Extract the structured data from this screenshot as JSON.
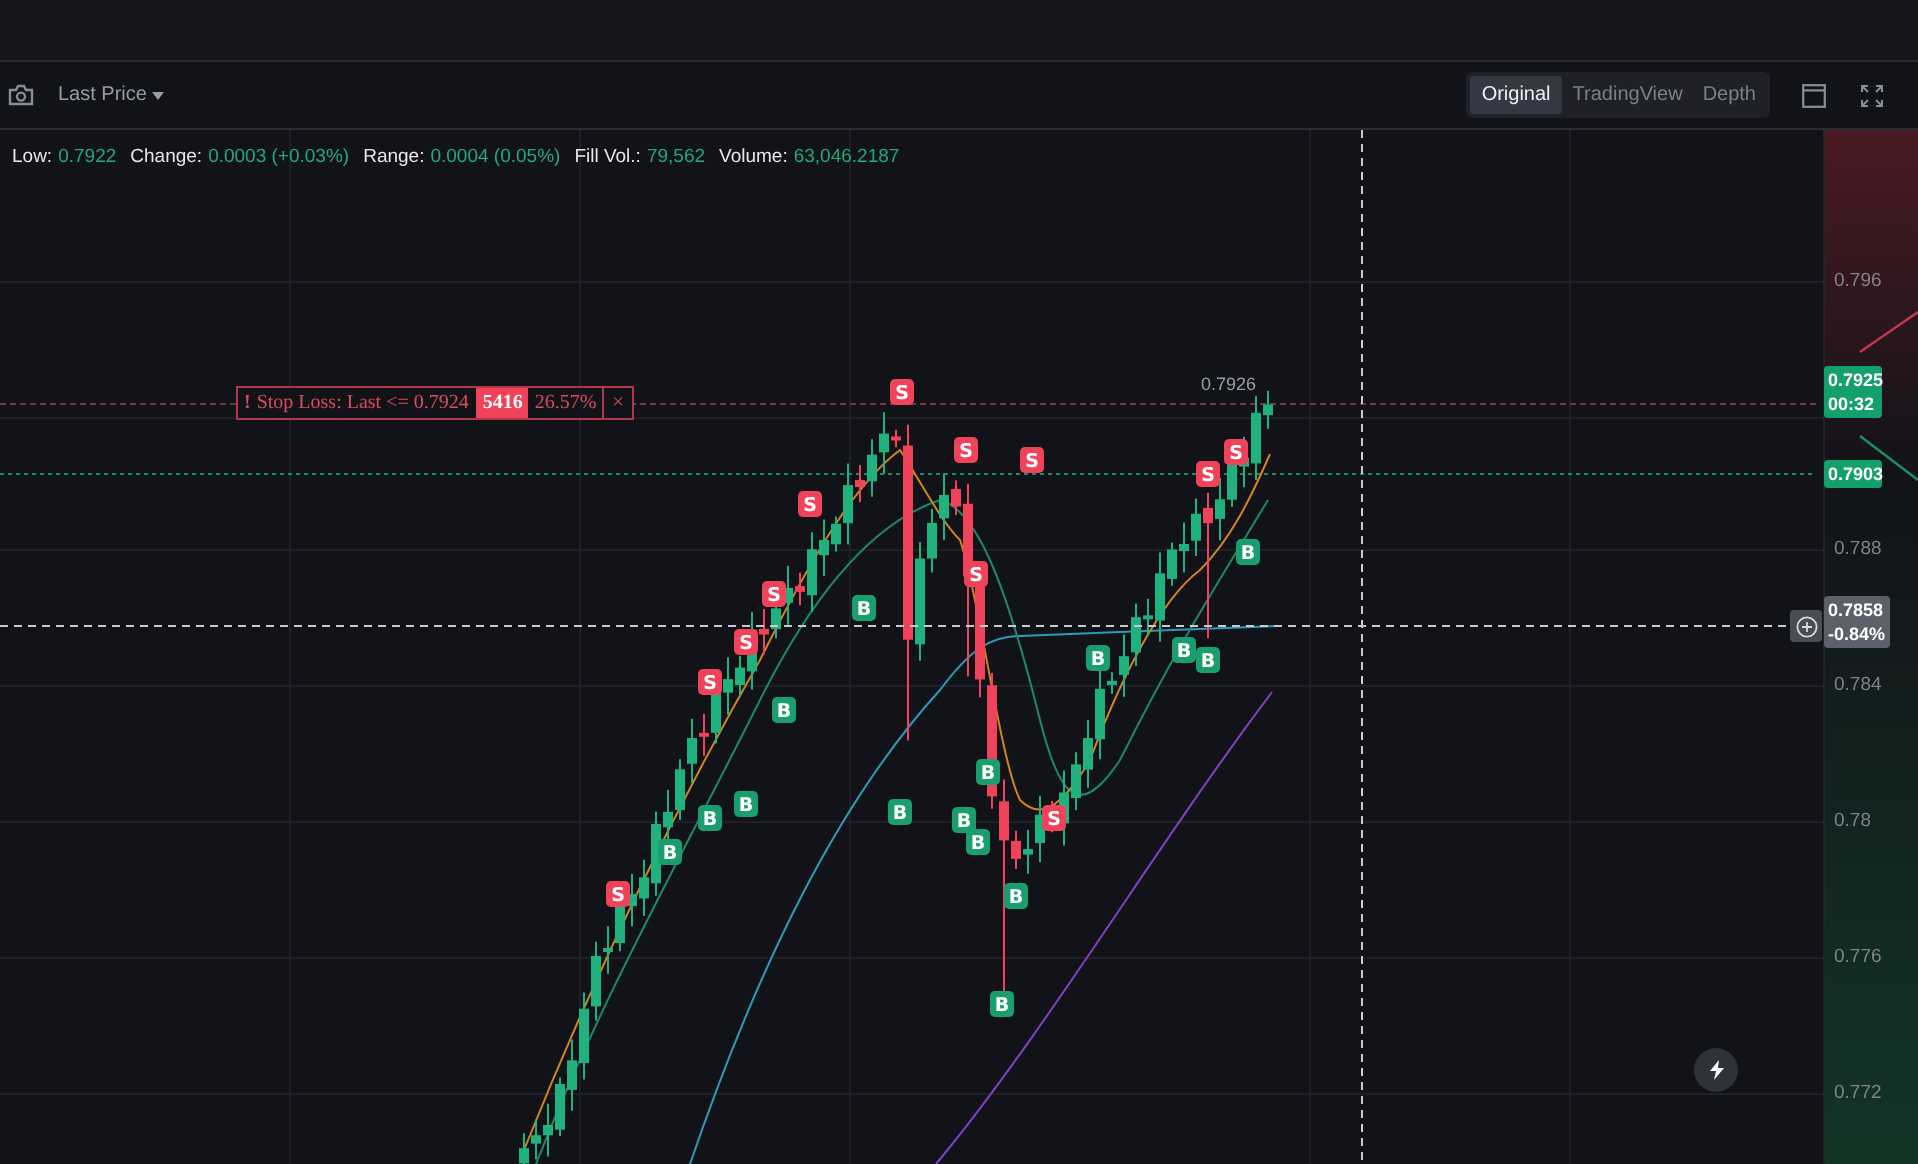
{
  "toolbar": {
    "price_type": "Last Price"
  },
  "view_tabs": [
    {
      "label": "Original",
      "selected": true
    },
    {
      "label": "TradingView",
      "selected": false
    },
    {
      "label": "Depth",
      "selected": false
    }
  ],
  "stats": [
    {
      "label": "Low:",
      "value": "0.7922"
    },
    {
      "label": "Change:",
      "value": "0.0003 (+0.03%)"
    },
    {
      "label": "Range:",
      "value": "0.0004 (0.05%)"
    },
    {
      "label": "Fill Vol.:",
      "value": "79,562"
    },
    {
      "label": "Volume:",
      "value": "63,046.2187"
    }
  ],
  "price_axis": {
    "ticks": [
      "0.796",
      "0.788",
      "0.784",
      "0.78",
      "0.776",
      "0.772"
    ]
  },
  "current_price": {
    "price": "0.7925",
    "countdown": "00:32"
  },
  "position_price": "0.7903",
  "crosshair": {
    "price": "0.7858",
    "change": "-0.84%"
  },
  "high_label": "0.7926",
  "stop_loss_order": {
    "alert_mark": "!",
    "label": "Stop Loss: Last <= 0.7924",
    "quantity": "5416",
    "percent": "26.57%",
    "close": "×"
  },
  "trade_markers": [
    {
      "kind": "sell",
      "label": "S"
    },
    {
      "kind": "sell",
      "label": "S"
    },
    {
      "kind": "sell",
      "label": "S"
    },
    {
      "kind": "sell",
      "label": "S"
    },
    {
      "kind": "sell",
      "label": "S"
    },
    {
      "kind": "sell",
      "label": "S"
    },
    {
      "kind": "sell",
      "label": "S"
    },
    {
      "kind": "sell",
      "label": "S"
    },
    {
      "kind": "sell",
      "label": "S"
    },
    {
      "kind": "sell",
      "label": "S"
    },
    {
      "kind": "sell",
      "label": "S"
    },
    {
      "kind": "sell",
      "label": "S"
    },
    {
      "kind": "buy",
      "label": "B"
    },
    {
      "kind": "buy",
      "label": "B"
    },
    {
      "kind": "buy",
      "label": "B"
    },
    {
      "kind": "buy",
      "label": "B"
    },
    {
      "kind": "buy",
      "label": "B"
    },
    {
      "kind": "buy",
      "label": "B"
    },
    {
      "kind": "buy",
      "label": "B"
    },
    {
      "kind": "buy",
      "label": "B"
    },
    {
      "kind": "buy",
      "label": "B"
    },
    {
      "kind": "buy",
      "label": "B"
    },
    {
      "kind": "buy",
      "label": "B"
    },
    {
      "kind": "buy",
      "label": "B"
    },
    {
      "kind": "buy",
      "label": "B"
    },
    {
      "kind": "buy",
      "label": "B"
    },
    {
      "kind": "buy",
      "label": "B"
    }
  ]
}
